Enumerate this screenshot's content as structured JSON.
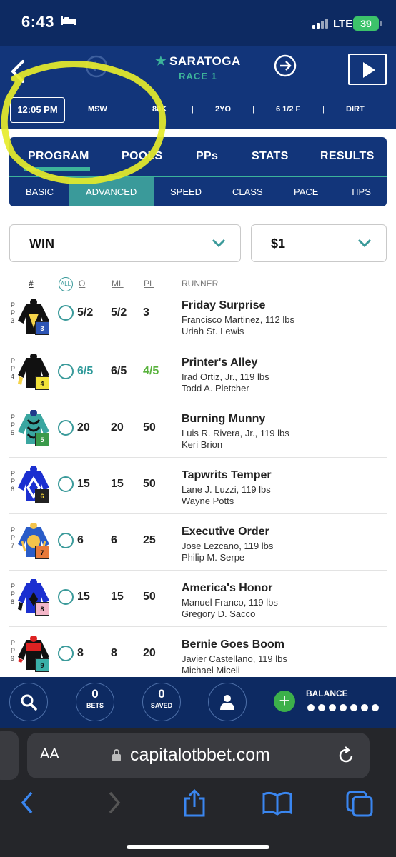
{
  "status": {
    "time": "6:43",
    "network": "LTE",
    "battery": "39"
  },
  "header": {
    "track": "SARATOGA",
    "race": "RACE 1"
  },
  "conditions": {
    "post_time": "12:05 PM",
    "items": [
      "MSW",
      "|",
      "80K",
      "|",
      "2YO",
      "|",
      "6 1/2 F",
      "|",
      "DIRT"
    ]
  },
  "tabs": {
    "main": [
      "PROGRAM",
      "POOLS",
      "PPs",
      "STATS",
      "RESULTS"
    ],
    "active_main": "PROGRAM",
    "sub": [
      "BASIC",
      "ADVANCED",
      "SPEED",
      "CLASS",
      "PACE",
      "TIPS"
    ],
    "active_sub": "ADVANCED"
  },
  "bet": {
    "type": "WIN",
    "amount": "$1"
  },
  "columns": {
    "num": "#",
    "all": "ALL",
    "odds": "O",
    "ml": "ML",
    "pl": "PL",
    "runner": "RUNNER"
  },
  "runners": [
    {
      "pp": "P P 3",
      "num": "3",
      "o": "5/2",
      "ml": "5/2",
      "pl": "3",
      "name": "Friday Surprise",
      "jockey": "Francisco Martinez, 112 lbs",
      "trainer": "Uriah St. Lewis",
      "badge_color": "#2d55b5",
      "badge_text": "#ffffff"
    },
    {
      "pp": "P P 4",
      "num": "4",
      "o": "6/5",
      "ml": "6/5",
      "pl": "4/5",
      "name": "Printer's Alley",
      "jockey": "Irad Ortiz, Jr., 119 lbs",
      "trainer": "Todd A. Pletcher",
      "badge_color": "#f2e23a",
      "badge_text": "#111111"
    },
    {
      "pp": "P P 5",
      "num": "5",
      "o": "20",
      "ml": "20",
      "pl": "50",
      "name": "Burning Munny",
      "jockey": "Luis R. Rivera, Jr., 119 lbs",
      "trainer": "Keri Brion",
      "badge_color": "#3a9a4a",
      "badge_text": "#ffffff"
    },
    {
      "pp": "P P 6",
      "num": "6",
      "o": "15",
      "ml": "15",
      "pl": "50",
      "name": "Tapwrits Temper",
      "jockey": "Lane J. Luzzi, 119 lbs",
      "trainer": "Wayne Potts",
      "badge_color": "#222222",
      "badge_text": "#f2d43a"
    },
    {
      "pp": "P P 7",
      "num": "7",
      "o": "6",
      "ml": "6",
      "pl": "25",
      "name": "Executive Order",
      "jockey": "Jose Lezcano, 119 lbs",
      "trainer": "Philip M. Serpe",
      "badge_color": "#e87a3a",
      "badge_text": "#111111"
    },
    {
      "pp": "P P 8",
      "num": "8",
      "o": "15",
      "ml": "15",
      "pl": "50",
      "name": "America's Honor",
      "jockey": "Manuel Franco, 119 lbs",
      "trainer": "Gregory D. Sacco",
      "badge_color": "#f4b6c8",
      "badge_text": "#111111"
    },
    {
      "pp": "P P 9",
      "num": "9",
      "o": "8",
      "ml": "8",
      "pl": "20",
      "name": "Bernie Goes Boom",
      "jockey": "Javier Castellano, 119 lbs",
      "trainer": "Michael Miceli",
      "badge_color": "#3ab0a8",
      "badge_text": "#111111"
    }
  ],
  "bottom": {
    "bets_count": "0",
    "bets_label": "BETS",
    "saved_count": "0",
    "saved_label": "SAVED",
    "balance_label": "BALANCE"
  },
  "browser": {
    "aa": "AA",
    "url": "capitalotbbet.com"
  },
  "colors": {
    "navy": "#12357a",
    "teal": "#3db39a",
    "green": "#58b23c",
    "highlighter": "#e6ec2a"
  }
}
